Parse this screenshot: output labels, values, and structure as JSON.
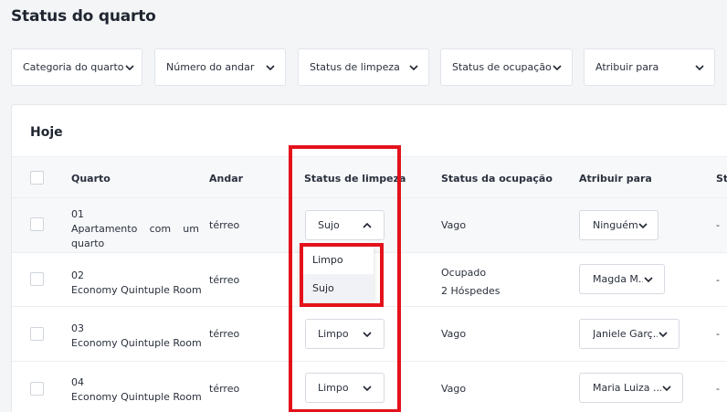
{
  "page": {
    "title": "Status do quarto"
  },
  "filters": [
    {
      "label": "Categoria do quarto"
    },
    {
      "label": "Número do andar"
    },
    {
      "label": "Status de limpeza"
    },
    {
      "label": "Status de ocupação"
    },
    {
      "label": "Atribuir para"
    }
  ],
  "card": {
    "title": "Hoje"
  },
  "table": {
    "headers": {
      "room": "Quarto",
      "floor": "Andar",
      "cleaning": "Status de limpeza",
      "occupancy": "Status da ocupação",
      "assign": "Atribuir para",
      "extra": "St"
    },
    "rows": [
      {
        "number": "01",
        "name": "Apartamento com um quarto",
        "floor": "térreo",
        "cleaning": "Sujo",
        "occupancy": "Vago",
        "occupancy_guests": "",
        "assign": "Ninguém",
        "extra": "-"
      },
      {
        "number": "02",
        "name": "Economy Quintuple Room",
        "floor": "térreo",
        "cleaning": "",
        "occupancy": "Ocupado",
        "occupancy_guests": "2 Hóspedes",
        "assign": "Magda M...",
        "extra": "-"
      },
      {
        "number": "03",
        "name": "Economy Quintuple Room",
        "floor": "térreo",
        "cleaning": "Limpo",
        "occupancy": "Vago",
        "occupancy_guests": "",
        "assign": "Janiele Garç...",
        "extra": "-"
      },
      {
        "number": "04",
        "name": "Economy Quintuple Room",
        "floor": "térreo",
        "cleaning": "Limpo",
        "occupancy": "Vago",
        "occupancy_guests": "",
        "assign": "Maria Luiza ...",
        "extra": "-"
      }
    ]
  },
  "cleaning_dropdown": {
    "options": [
      "Limpo",
      "Sujo"
    ],
    "selected": "Sujo"
  },
  "colors": {
    "highlight": "#e3121b",
    "background": "#f4f5f7",
    "text": "#1f2530"
  },
  "icons": {
    "dropdown": "chevron-down-icon",
    "open_dropdown": "chevron-up-icon"
  }
}
